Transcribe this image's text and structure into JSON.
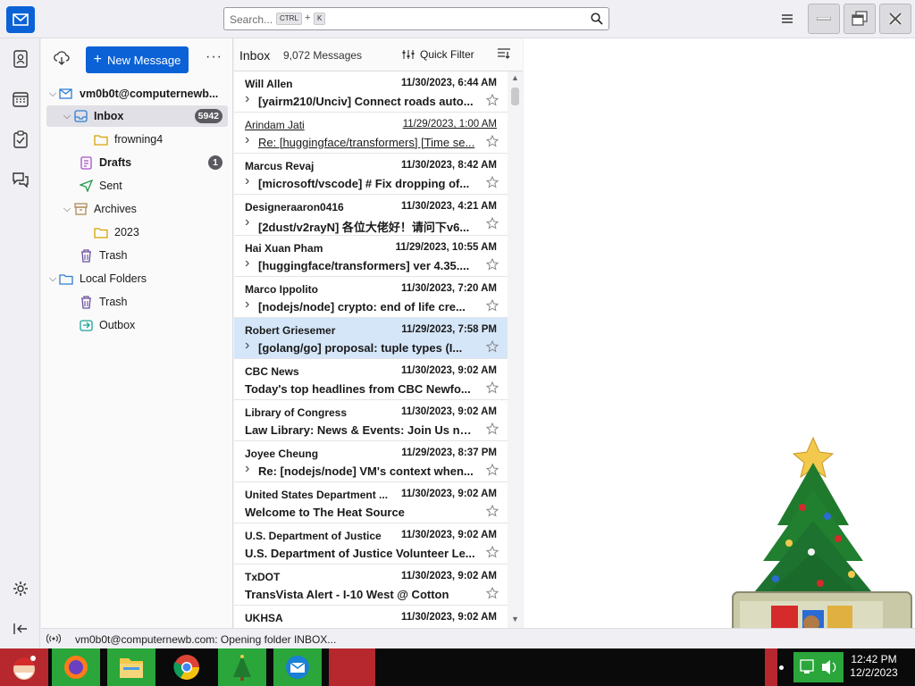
{
  "titlebar": {
    "search_placeholder": "Search...",
    "shortcut_key1": "CTRL",
    "shortcut_plus": "+",
    "shortcut_key2": "K"
  },
  "folder_pane": {
    "new_message_label": "New Message",
    "more_label": "···",
    "account": "vm0b0t@computernewb...",
    "inbox_label": "Inbox",
    "inbox_count": "5942",
    "frowning_label": "frowning4",
    "drafts_label": "Drafts",
    "drafts_count": "1",
    "sent_label": "Sent",
    "archives_label": "Archives",
    "archive_2023_label": "2023",
    "trash_label": "Trash",
    "local_folders_label": "Local Folders",
    "local_trash_label": "Trash",
    "outbox_label": "Outbox"
  },
  "message_list": {
    "title": "Inbox",
    "count": "9,072 Messages",
    "quick_filter_label": "Quick Filter",
    "messages": [
      {
        "sender": "Will Allen",
        "date": "11/30/2023, 6:44 AM",
        "subject": "[yairm210/Unciv] Connect roads auto...",
        "thread": true,
        "read": false
      },
      {
        "sender": "Arindam Jati",
        "date": "11/29/2023, 1:00 AM",
        "subject": "Re: [huggingface/transformers] [Time se...",
        "thread": true,
        "read": true
      },
      {
        "sender": "Marcus Revaj",
        "date": "11/30/2023, 8:42 AM",
        "subject": "[microsoft/vscode] # Fix dropping of...",
        "thread": true,
        "read": false
      },
      {
        "sender": "Designeraaron0416",
        "date": "11/30/2023, 4:21 AM",
        "subject": "[2dust/v2rayN] 各位大佬好！请问下v6...",
        "thread": true,
        "read": false
      },
      {
        "sender": "Hai Xuan Pham",
        "date": "11/29/2023, 10:55 AM",
        "subject": "[huggingface/transformers] ver 4.35....",
        "thread": true,
        "read": false
      },
      {
        "sender": "Marco Ippolito",
        "date": "11/30/2023, 7:20 AM",
        "subject": "[nodejs/node] crypto: end of life cre...",
        "thread": true,
        "read": false
      },
      {
        "sender": "Robert Griesemer",
        "date": "11/29/2023, 7:58 PM",
        "subject": "[golang/go] proposal: tuple types (I...",
        "thread": true,
        "read": false
      },
      {
        "sender": "CBC News",
        "date": "11/30/2023, 9:02 AM",
        "subject": "Today's top headlines from CBC Newfo...",
        "thread": false,
        "read": false
      },
      {
        "sender": "Library of Congress",
        "date": "11/30/2023, 9:02 AM",
        "subject": "Law Library: News & Events: Join Us ne...",
        "thread": false,
        "read": false
      },
      {
        "sender": "Joyee Cheung",
        "date": "11/29/2023, 8:37 PM",
        "subject": "Re: [nodejs/node] VM's context when...",
        "thread": true,
        "read": false
      },
      {
        "sender": "United States Department ...",
        "date": "11/30/2023, 9:02 AM",
        "subject": "Welcome to The Heat Source",
        "thread": false,
        "read": false
      },
      {
        "sender": "U.S. Department of Justice",
        "date": "11/30/2023, 9:02 AM",
        "subject": "U.S. Department of Justice Volunteer Le...",
        "thread": false,
        "read": false
      },
      {
        "sender": "TxDOT",
        "date": "11/30/2023, 9:02 AM",
        "subject": "TransVista Alert - I-10 West @ Cotton",
        "thread": false,
        "read": false
      },
      {
        "sender": "UKHSA",
        "date": "11/30/2023, 9:02 AM",
        "subject": "",
        "thread": false,
        "read": false
      }
    ],
    "selected_index": 6
  },
  "status": {
    "text": "vm0b0t@computernewb.com: Opening folder INBOX..."
  },
  "taskbar": {
    "time": "12:42 PM",
    "date": "12/2/2023"
  },
  "colors": {
    "accent": "#0a62d6",
    "selected_row": "#d5e6f9",
    "taskbar_green": "#2aa63a",
    "taskbar_red": "#b6282e"
  }
}
